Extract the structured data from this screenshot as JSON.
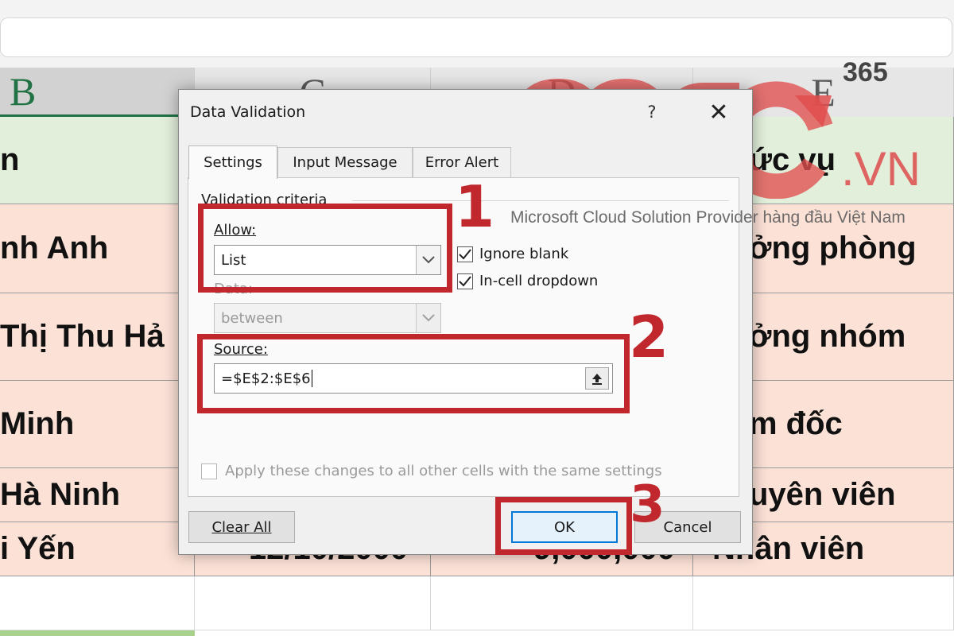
{
  "columns": [
    "B",
    "C",
    "D",
    "E"
  ],
  "sheet": {
    "header_row": {
      "b": "n",
      "e": "ức vụ"
    },
    "rows": [
      {
        "b": "nh Anh",
        "c": "",
        "d": "",
        "e": "ởng phòng"
      },
      {
        "b": "Thị Thu Hả",
        "c": "",
        "d": "",
        "e": "ởng nhóm"
      },
      {
        "b": " Minh",
        "c": "",
        "d": "",
        "e": "m đốc"
      },
      {
        "b": "Hà Ninh",
        "c": "",
        "d": "",
        "e": "uyên viên"
      },
      {
        "b": "i Yến",
        "c": "12/10/2000",
        "d": "9,000,000",
        "e": "Nhân viên"
      }
    ]
  },
  "dialog": {
    "title": "Data Validation",
    "help_label": "?",
    "close_label": "✕",
    "tabs": [
      "Settings",
      "Input Message",
      "Error Alert"
    ],
    "active_tab": "Settings",
    "criteria_label": "Validation criteria",
    "allow_label": "Allow:",
    "allow_value": "List",
    "data_label": "Data:",
    "data_value": "between",
    "ignore_blank_label": "Ignore blank",
    "ignore_blank_checked": true,
    "incell_dropdown_label": "In-cell dropdown",
    "incell_dropdown_checked": true,
    "source_label": "Source:",
    "source_value": "=$E$2:$E$6",
    "apply_all_label": "Apply these changes to all other cells with the same settings",
    "apply_all_checked": false,
    "clear_all_label": "Clear All",
    "ok_label": "OK",
    "cancel_label": "Cancel"
  },
  "annotations": {
    "steps": [
      "1",
      "2",
      "3"
    ],
    "highlight_color": "#c0282d"
  },
  "watermark": {
    "brand_365": "365",
    "brand_vn": ".VN",
    "tagline": "Microsoft Cloud Solution Provider hàng đầu Việt Nam",
    "brand_color": "#e05555"
  }
}
